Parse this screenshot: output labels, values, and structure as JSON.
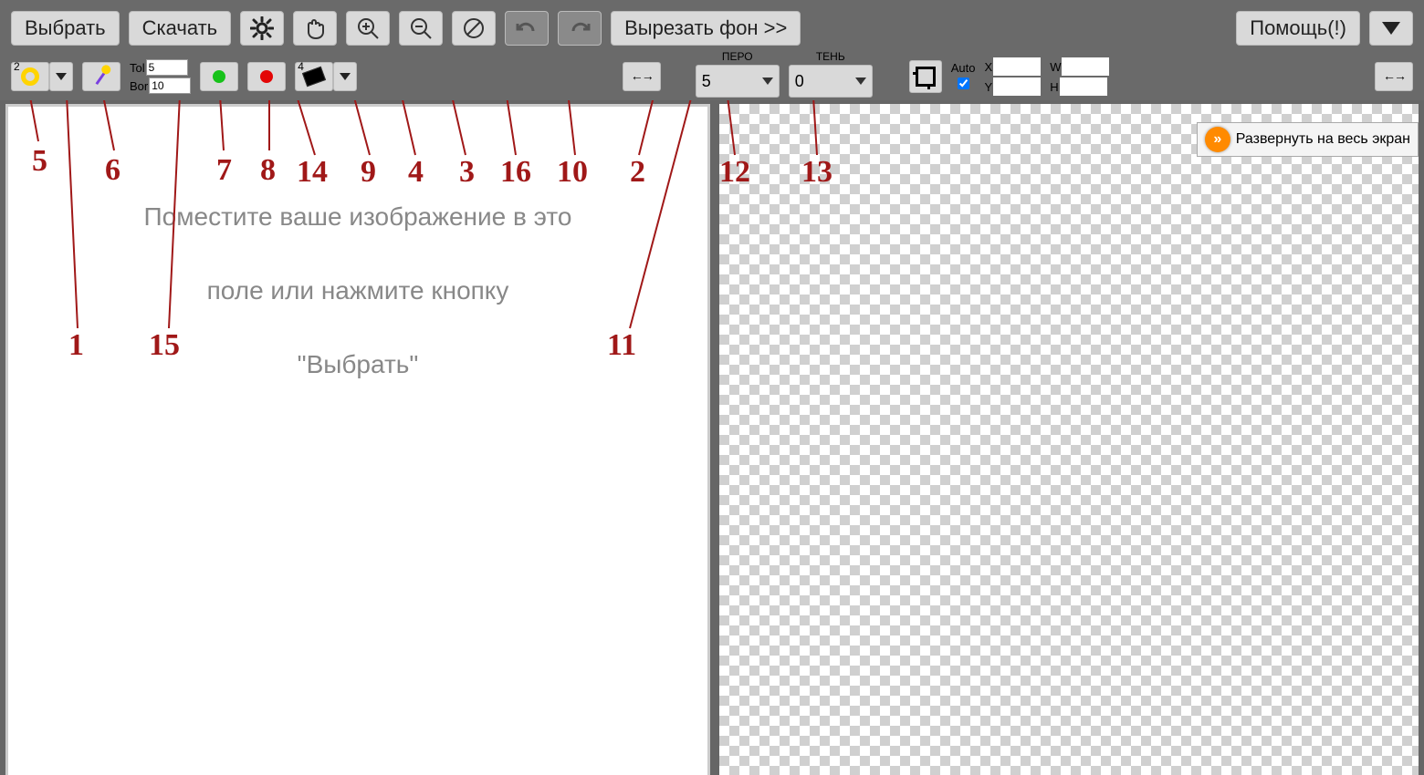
{
  "toolbar": {
    "select": "Выбрать",
    "download": "Скачать",
    "cut_bg": "Вырезать фон >>",
    "help": "Помощь(!)"
  },
  "row2": {
    "tol_label": "Tol",
    "tol_value": "5",
    "bor_label": "Bor",
    "bor_value": "10",
    "wand_sup": "2",
    "eraser_sup": "4",
    "pen_header": "ПЕРО",
    "shadow_header": "ТЕНЬ",
    "pen_value": "5",
    "shadow_value": "0",
    "auto_label": "Auto",
    "auto_checked": true,
    "x": "X",
    "y": "Y",
    "w": "W",
    "h": "H"
  },
  "placeholder": {
    "line1": "Поместите ваше изображение в это",
    "line2": "поле или нажмите кнопку",
    "line3": "\"Выбрать\""
  },
  "right_panel": {
    "expand": "Развернуть на весь экран"
  },
  "annotations": {
    "n1": "1",
    "n2": "2",
    "n3": "3",
    "n4": "4",
    "n5": "5",
    "n6": "6",
    "n7": "7",
    "n8": "8",
    "n9": "9",
    "n10": "10",
    "n11": "11",
    "n12": "12",
    "n13": "13",
    "n14": "14",
    "n15": "15",
    "n16": "16"
  }
}
